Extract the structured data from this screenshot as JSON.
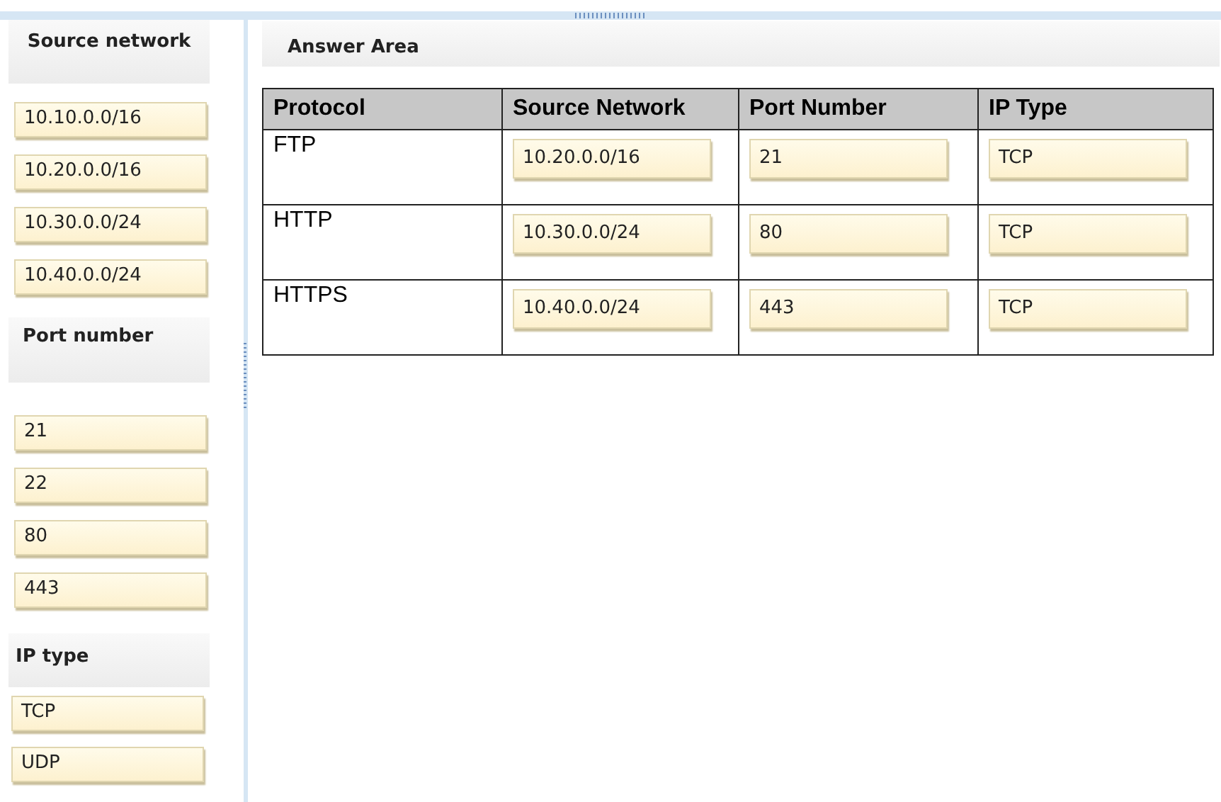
{
  "source_groups": [
    {
      "title": "Source network",
      "items": [
        "10.10.0.0/16",
        "10.20.0.0/16",
        "10.30.0.0/24",
        "10.40.0.0/24"
      ]
    },
    {
      "title": "Port number",
      "items": [
        "21",
        "22",
        "80",
        "443"
      ]
    },
    {
      "title": "IP type",
      "items": [
        "TCP",
        "UDP"
      ]
    }
  ],
  "answer_area": {
    "title": "Answer Area",
    "table": {
      "columns": [
        "Protocol",
        "Source Network",
        "Port Number",
        "IP Type"
      ],
      "rows": [
        {
          "protocol": "FTP",
          "answers": [
            "10.20.0.0/16",
            "21",
            "TCP"
          ]
        },
        {
          "protocol": "HTTP",
          "answers": [
            "10.30.0.0/24",
            "80",
            "TCP"
          ]
        },
        {
          "protocol": "HTTPS",
          "answers": [
            "10.40.0.0/24",
            "443",
            "TCP"
          ]
        }
      ]
    }
  }
}
